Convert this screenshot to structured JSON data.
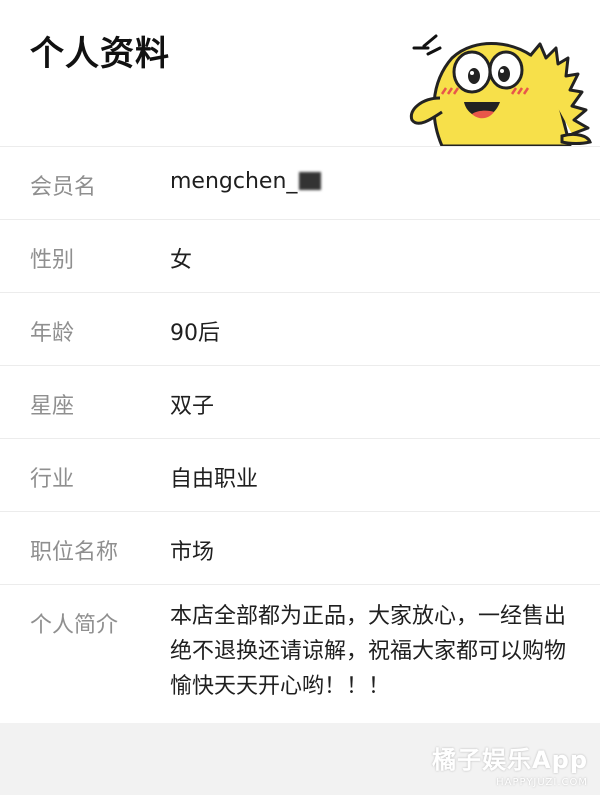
{
  "header": {
    "title": "个人资料",
    "mascot_icon": "yellow-cartoon-fish-mascot-icon"
  },
  "profile": {
    "fields": [
      {
        "label": "会员名",
        "value": "mengchen_"
      },
      {
        "label": "性别",
        "value": "女"
      },
      {
        "label": "年龄",
        "value": "90后"
      },
      {
        "label": "星座",
        "value": "双子"
      },
      {
        "label": "行业",
        "value": "自由职业"
      },
      {
        "label": "职位名称",
        "value": "市场"
      },
      {
        "label": "个人简介",
        "value": "本店全部都为正品，大家放心，一经售出绝不退换还请谅解，祝福大家都可以购物愉快天天开心哟！！！"
      }
    ]
  },
  "watermark": {
    "main": "橘子娱乐App",
    "sub": "HAPPYJUZI.COM"
  },
  "colors": {
    "label": "#8f8f8f",
    "value": "#1f1f1f",
    "divider": "#ececec",
    "mascot_yellow": "#f7e04a"
  }
}
